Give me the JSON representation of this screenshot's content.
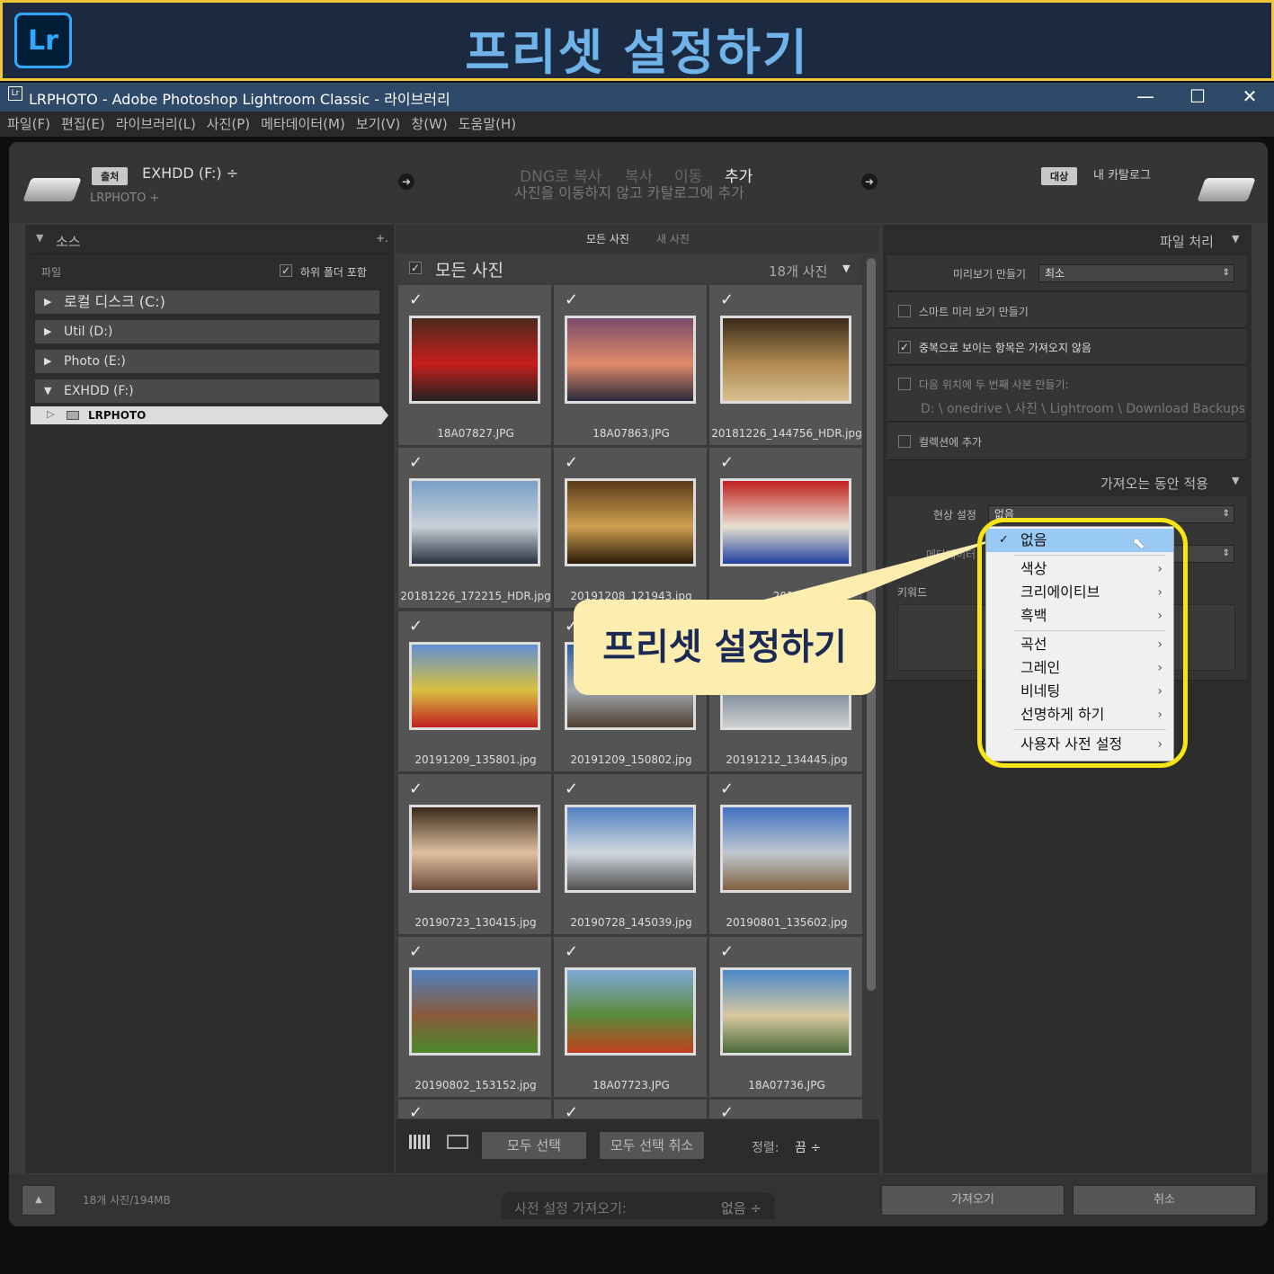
{
  "banner": {
    "logo": "Lr",
    "title": "프리셋 설정하기"
  },
  "window": {
    "title": "LRPHOTO - Adobe Photoshop Lightroom Classic - 라이브러리",
    "minimize": "—",
    "maximize": "☐",
    "close": "✕"
  },
  "menubar": [
    "파일(F)",
    "편집(E)",
    "라이브러리(L)",
    "사진(P)",
    "메타데이터(M)",
    "보기(V)",
    "창(W)",
    "도움말(H)"
  ],
  "import_header": {
    "source_tag": "출처",
    "source_drive": "EXHDD (F:) ÷",
    "source_sub": "LRPHOTO +",
    "modes": [
      "DNG로 복사",
      "복사",
      "이동",
      "추가"
    ],
    "mode_desc": "사진을 이동하지 않고 카탈로그에 추가",
    "dest_tag": "대상",
    "dest_label": "내 카탈로그"
  },
  "source_panel": {
    "title": "소스",
    "plus": "+.",
    "files_label": "파일",
    "include_subfolders": "하위 폴더 포함",
    "volumes": [
      {
        "label": "로컬 디스크 (C:)",
        "tri": "▶"
      },
      {
        "label": "Util (D:)",
        "tri": "▶"
      },
      {
        "label": "Photo (E:)",
        "tri": "▶"
      },
      {
        "label": "EXHDD (F:)",
        "tri": "▼"
      }
    ],
    "folder": "LRPHOTO"
  },
  "grid": {
    "tabs": [
      "모든 사진",
      "새 사진"
    ],
    "header": "모든 사진",
    "count": "18개 사진",
    "files": [
      "18A07827.JPG",
      "18A07863.JPG",
      "20181226_144756_HDR.jpg",
      "20181226_172215_HDR.jpg",
      "20191208_121943.jpg",
      "2019",
      "20191209_135801.jpg",
      "20191209_150802.jpg",
      "20191212_134445.jpg",
      "20190723_130415.jpg",
      "20190728_145039.jpg",
      "20190801_135602.jpg",
      "20190802_153152.jpg",
      "18A07723.JPG",
      "18A07736.JPG"
    ],
    "select_all": "모두 선택",
    "deselect_all": "모두 선택 취소",
    "sort_label": "정렬:",
    "sort_value": "끔 ÷"
  },
  "right_panel": {
    "file_handling": "파일 처리",
    "preview_label": "미리보기 만들기",
    "preview_value": "최소",
    "smart_preview": "스마트 미리 보기 만들기",
    "no_duplicates": "중복으로 보이는 항목은 가져오지 않음",
    "second_copy": "다음 위치에 두 번째 사본 만들기:",
    "backup_path": "D: \\ onedrive \\ 사진 \\ Lightroom \\ Download Backups",
    "add_collection": "컬렉션에 추가",
    "apply_during_import": "가져오는 동안 적용",
    "develop_label": "현상 설정",
    "develop_value": "없음",
    "metadata_label": "메타데이터",
    "keywords_label": "키워드"
  },
  "dropdown": {
    "items": [
      "없음",
      "색상",
      "크리에이티브",
      "흑백",
      "곡선",
      "그레인",
      "비네팅",
      "선명하게 하기",
      "사용자 사전 설정"
    ]
  },
  "callout": "프리셋 설정하기",
  "bottom": {
    "summary": "18개 사진/194MB",
    "preset_label": "사전 설정 가져오기:",
    "preset_value": "없음 ÷",
    "import": "가져오기",
    "cancel": "취소"
  },
  "colors": {
    "banner_bg": "#1b2a40",
    "banner_border": "#f0c53a",
    "title_blue": "#6fb3e8",
    "highlight": "#f5e514",
    "callout_bg": "#fdeeb0",
    "menu_selected": "#99c9f5"
  }
}
